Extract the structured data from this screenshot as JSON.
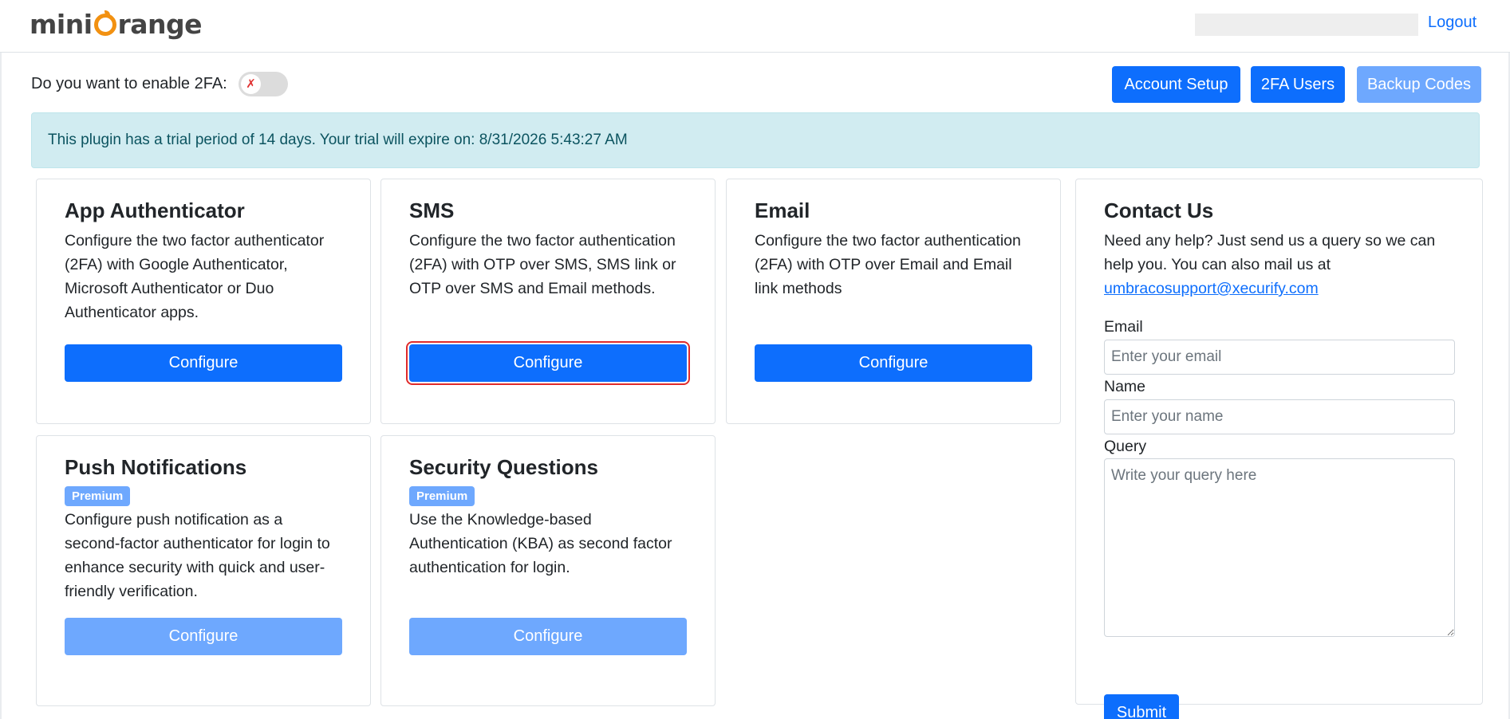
{
  "header": {
    "brand": "miniOrange",
    "brand_left": "mini",
    "brand_right": "range",
    "logout": "Logout"
  },
  "toolbar": {
    "enable_label": "Do you want to enable 2FA:",
    "toggle_state": "off",
    "toggle_glyph": "✗",
    "buttons": {
      "account_setup": "Account Setup",
      "users": "2FA Users",
      "backup_codes": "Backup Codes"
    }
  },
  "trial_notice": "This plugin has a trial period of 14 days. Your trial will expire on: 8/31/2026 5:43:27 AM",
  "methods": [
    {
      "title": "App Authenticator",
      "description": "Configure the two factor authenticator (2FA) with Google Authenticator, Microsoft Authenticator or Duo Authenticator apps.",
      "button": "Configure",
      "premium": false,
      "enabled": true
    },
    {
      "title": "SMS",
      "description": "Configure the two factor authentication (2FA) with OTP over SMS, SMS link or OTP over SMS and Email methods.",
      "button": "Configure",
      "premium": false,
      "enabled": true,
      "highlighted": true
    },
    {
      "title": "Email",
      "description": "Configure the two factor authentication (2FA) with OTP over Email and Email link methods",
      "button": "Configure",
      "premium": false,
      "enabled": true
    },
    {
      "title": "Push Notifications",
      "badge": "Premium",
      "description": "Configure push notification as a second-factor authenticator for login to enhance security with quick and user-friendly verification.",
      "button": "Configure",
      "premium": true,
      "enabled": false
    },
    {
      "title": "Security Questions",
      "badge": "Premium",
      "description": "Use the Knowledge-based Authentication (KBA) as second factor authentication for login.",
      "button": "Configure",
      "premium": true,
      "enabled": false
    }
  ],
  "contact": {
    "title": "Contact Us",
    "description": "Need any help? Just send us a query so we can help you. You can also mail us at",
    "email_link": "umbracosupport@xecurify.com",
    "email_label": "Email",
    "email_placeholder": "Enter your email",
    "name_label": "Name",
    "name_placeholder": "Enter your name",
    "query_label": "Query",
    "query_placeholder": "Write your query here",
    "submit": "Submit"
  },
  "colors": {
    "primary": "#0d6efd",
    "primary_disabled": "#6ea8fe",
    "alert_bg": "#d1ecf1",
    "alert_text": "#0c5460",
    "logo_orange": "#f29111",
    "highlight": "#e02b2b"
  }
}
